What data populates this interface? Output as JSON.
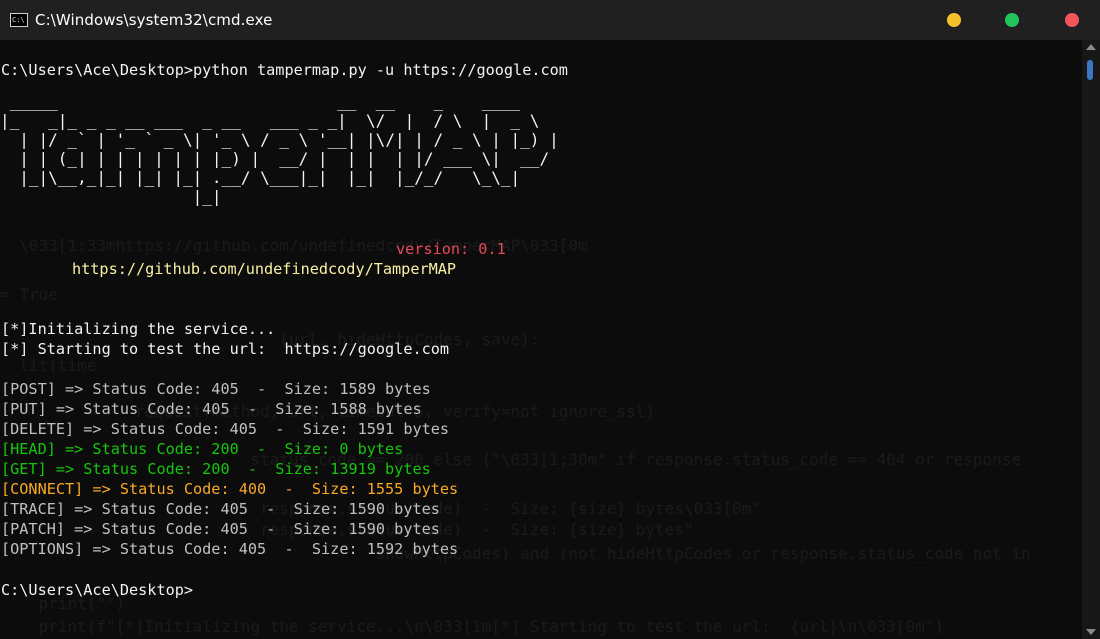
{
  "window": {
    "title": "C:\\Windows\\system32\\cmd.exe",
    "icon_label": "C:\\",
    "icon": "console-icon",
    "buttons": {
      "minimize_color": "#f6c02c",
      "maximize_color": "#21c35a",
      "close_color": "#f25656"
    }
  },
  "terminal": {
    "command_line": "C:\\Users\\Ace\\Desktop>python tampermap.py -u https://google.com",
    "banner_art": [
      " _____                             __  __    _    ____",
      "|_   _|_ _ _ __ ___  _ __   ___ _ _|  \\/  |  / \\  |  _ \\",
      "  | |/ _` | '_ ` _ \\| '_ \\ / _ \\ '__| |\\/| | / _ \\ | |_) |",
      "  | | (_| | | | | | | |_) |  __/ |  | |  | |/ ___ \\|  __/",
      "  |_|\\__,_|_| |_| |_| .__/ \\___|_|  |_|  |_/_/   \\_\\_|",
      "                    |_|"
    ],
    "version": "version: 0.1",
    "repo_url": "https://github.com/undefinedcody/TamperMAP",
    "init_msg": "[*]Initializing the service...",
    "start_msg": "[*] Starting to test the url:  https://google.com",
    "results": [
      {
        "text": "[POST] => Status Code: 405  -  Size: 1589 bytes",
        "status": "405",
        "color": "#c0c0c0"
      },
      {
        "text": "[PUT] => Status Code: 405  -  Size: 1588 bytes",
        "status": "405",
        "color": "#c0c0c0"
      },
      {
        "text": "[DELETE] => Status Code: 405  -  Size: 1591 bytes",
        "status": "405",
        "color": "#c0c0c0"
      },
      {
        "text": "[HEAD] => Status Code: 200  -  Size: 0 bytes",
        "status": "200",
        "color": "#16c60c"
      },
      {
        "text": "[GET] => Status Code: 200  -  Size: 13919 bytes",
        "status": "200",
        "color": "#16c60c"
      },
      {
        "text": "[CONNECT] => Status Code: 400  -  Size: 1555 bytes",
        "status": "400",
        "color": "#f9a825"
      },
      {
        "text": "[TRACE] => Status Code: 405  -  Size: 1590 bytes",
        "status": "405",
        "color": "#c0c0c0"
      },
      {
        "text": "[PATCH] => Status Code: 405  -  Size: 1590 bytes",
        "status": "405",
        "color": "#c0c0c0"
      },
      {
        "text": "[OPTIONS] => Status Code: 405  -  Size: 1592 bytes",
        "status": "405",
        "color": "#c0c0c0"
      }
    ],
    "prompt": "C:\\Users\\Ace\\Desktop>",
    "ghost_lines": [
      {
        "text": "  \\033[1;33mhttps://github.com/undefinedcody/TamperMAP\\033[0m"
      },
      {
        "text": "= True"
      },
      {
        "text": "                             (url, hideHttpCodes, save):"
      },
      {
        "text": "  lit(time"
      },
      {
        "text": "              request(method, url, timeout=5, verify=not ignore_ssl)"
      },
      {
        "text": "                          status_code == 200 else (\"\\033[1;30m\" if response.status_code == 404 or response"
      },
      {
        "text": "                           response.status_code)  -  Size: {size} bytes\\033[0m\""
      },
      {
        "text": "                           response.status_code)  -  Size: {size} bytes\""
      },
      {
        "text": "                                       showHttpCodes) and (not hideHttpCodes or response.status_code not in"
      },
      {
        "text": "    print(\"\")"
      },
      {
        "text": "    print(f\"[*]Initializing the service...\\n\\033[1m[*] Starting to test the url:  {url}\\n\\033[0m\")"
      }
    ]
  },
  "scrollbar": {
    "thumb_color": "#3b78c4"
  }
}
